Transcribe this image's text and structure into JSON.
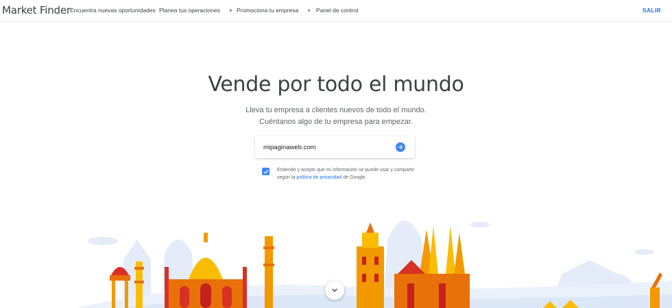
{
  "header": {
    "brand": "Market Finder",
    "nav": [
      {
        "label": "Encuentra nuevas oportunidades"
      },
      {
        "label": "Planea tus operaciones"
      },
      {
        "label": "Promociona tu empresa"
      },
      {
        "label": "Panel de control"
      }
    ],
    "salir": "SALIR"
  },
  "hero": {
    "title": "Vende por todo el mundo",
    "line1": "Lleva tu empresa a clientes nuevos de todo el mundo.",
    "line2": "Cuéntanos algo de tu empresa para empezar."
  },
  "url_form": {
    "value": "mipaginaweb.com",
    "submit_icon": "arrow-right-icon"
  },
  "consent": {
    "checked": true,
    "text_before": "Entiendo y acepto que mi información se puede usar y compartir según la ",
    "link": "política de privacidad",
    "text_after": " de Google."
  },
  "colors": {
    "accent": "#4285f4",
    "link": "#1a73e8",
    "text": "#3c4043",
    "muted": "#5f6368"
  },
  "scroll_icon": "chevron-down-icon"
}
